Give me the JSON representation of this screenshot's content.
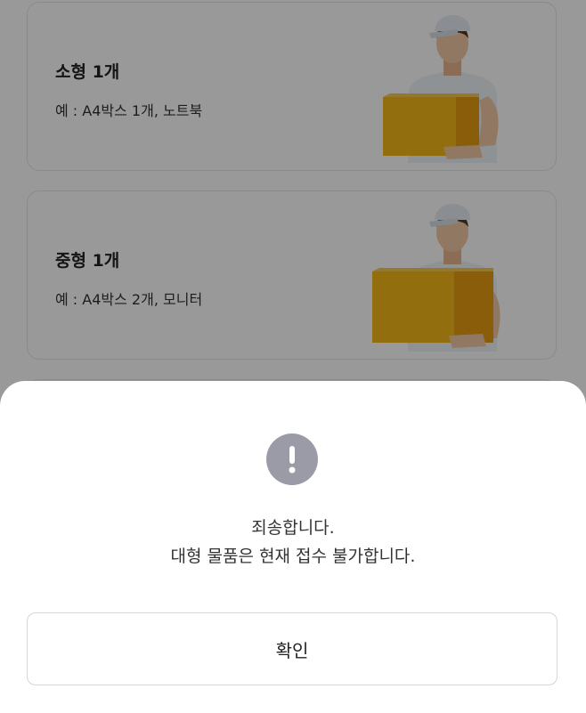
{
  "cards": [
    {
      "title": "소형 1개",
      "example": "예 : A4박스 1개, 노트북",
      "illustration": "delivery-man-small-box"
    },
    {
      "title": "중형 1개",
      "example": "예 : A4박스 2개, 모니터",
      "illustration": "delivery-man-medium-box"
    }
  ],
  "dialog": {
    "icon": "exclamation-icon",
    "line1": "죄송합니다.",
    "line2": "대형 물품은 현재 접수 불가합니다.",
    "confirm_label": "확인"
  },
  "colors": {
    "box": "#f6b719",
    "box_side": "#e59c10",
    "cap": "#e6ecf2",
    "skin": "#f2c9a3",
    "shirt": "#eef3f9",
    "alert_icon_bg": "#9a9ba6",
    "overlay": "rgba(0,0,0,0.40)"
  }
}
